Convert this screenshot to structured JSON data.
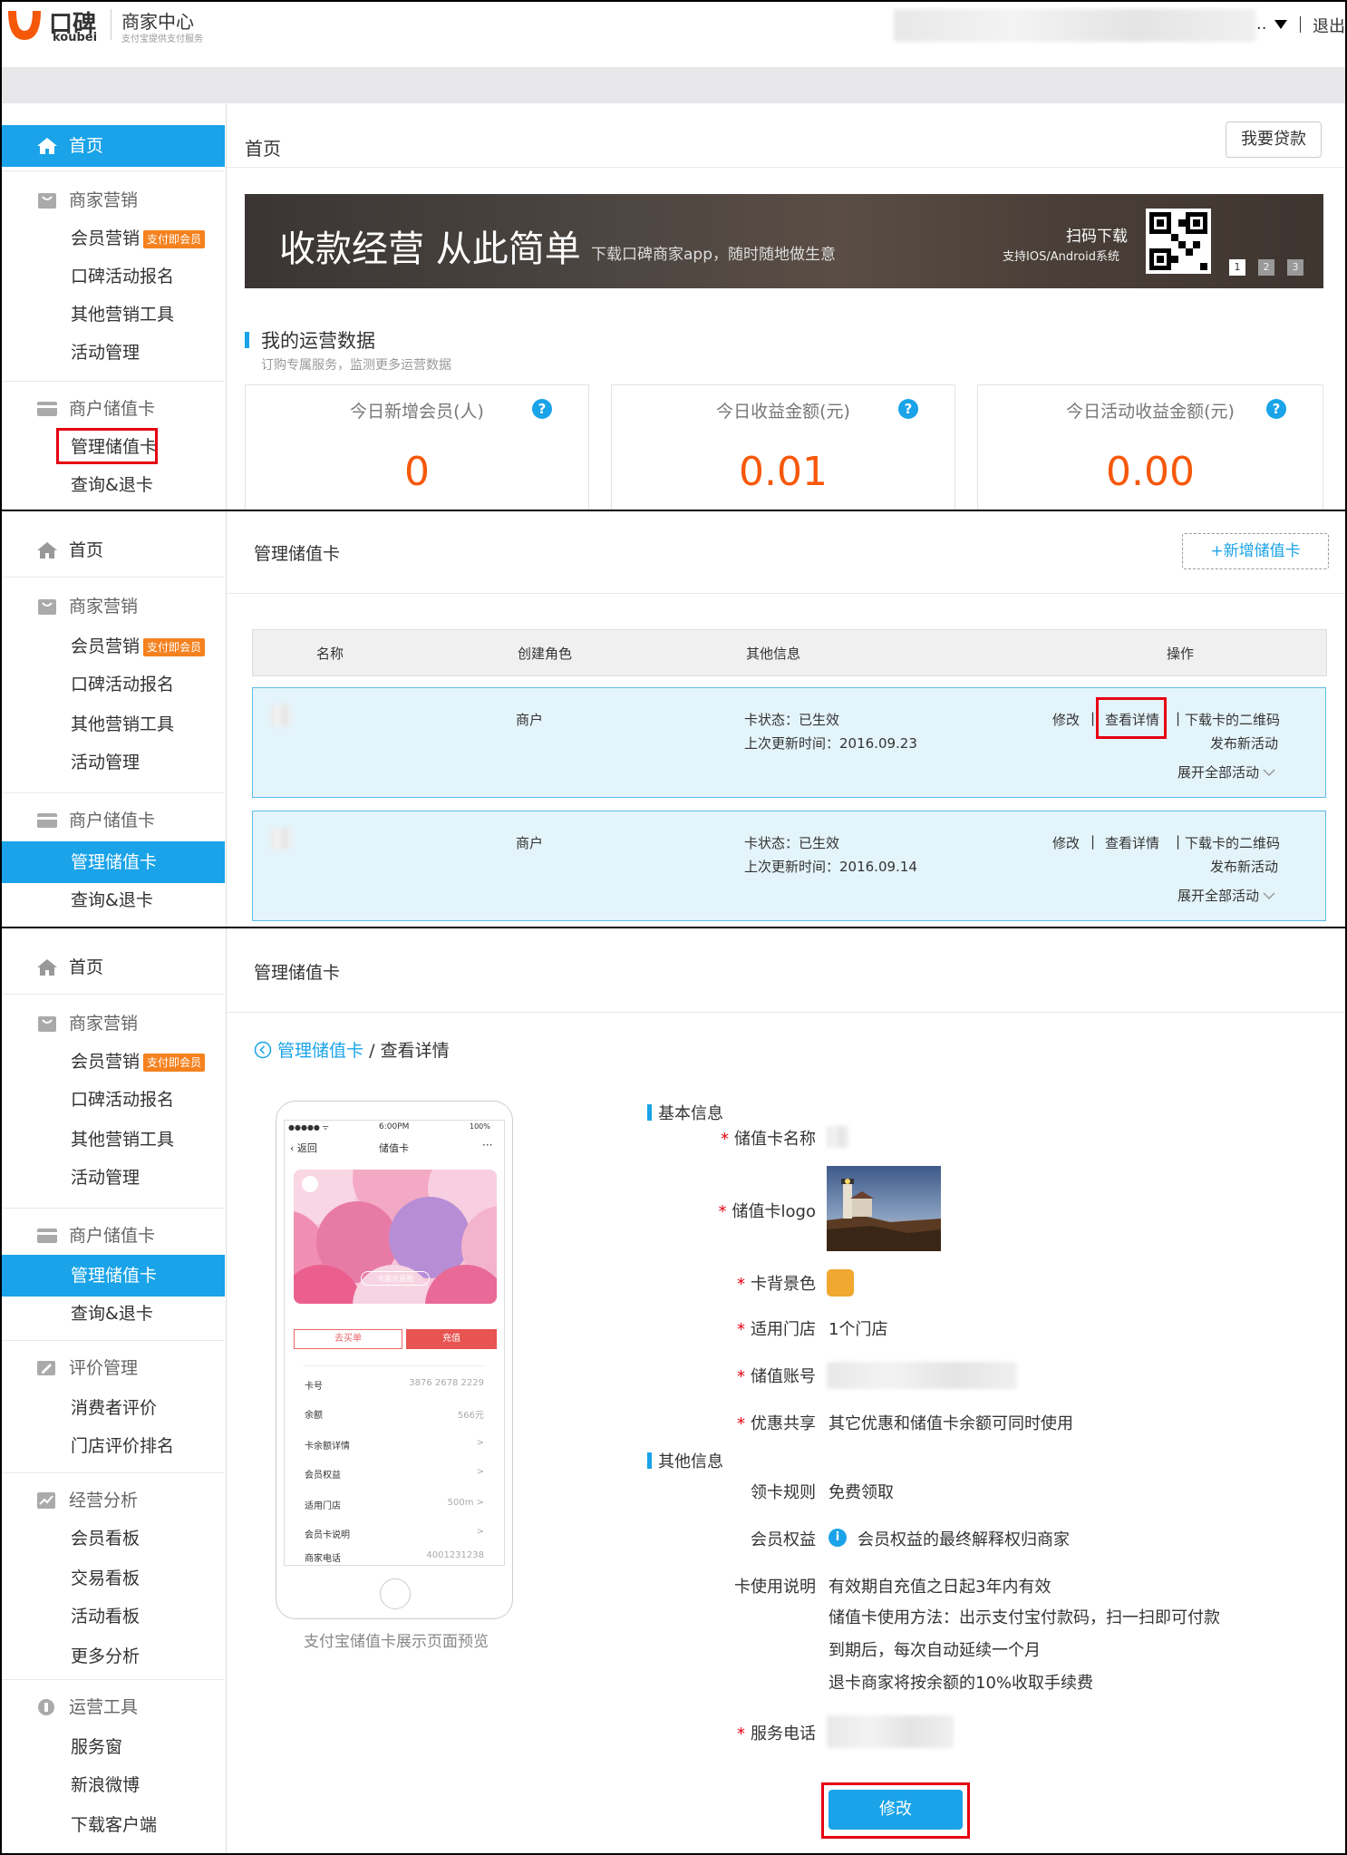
{
  "header": {
    "logo_cn": "口碑",
    "logo_en": "koubei",
    "center_title": "商家中心",
    "center_sub": "支付宝提供支付服务",
    "account_suffix": "..",
    "logout": "退出"
  },
  "sidebar": {
    "home": "首页",
    "marketing_group": "商家营销",
    "member_marketing": "会员营销",
    "member_tag": "支付即会员",
    "activity_signup": "口碑活动报名",
    "other_tools": "其他营销工具",
    "activity_manage": "活动管理",
    "card_group": "商户储值卡",
    "manage_card": "管理储值卡",
    "query_refund": "查询&退卡",
    "review_group": "评价管理",
    "consumer_review": "消费者评价",
    "store_rank": "门店评价排名",
    "analysis_group": "经营分析",
    "member_board": "会员看板",
    "trade_board": "交易看板",
    "activity_board": "活动看板",
    "more_analysis": "更多分析",
    "ops_group": "运营工具",
    "service_window": "服务窗",
    "weibo": "新浪微博",
    "download_client": "下载客户端"
  },
  "panel1": {
    "page_title": "首页",
    "loan_button": "我要贷款",
    "banner_title": "收款经营 从此简单",
    "banner_sub": "下载口碑商家app，随时随地做生意",
    "banner_scan": "扫码下载",
    "banner_os": "支持IOS/Android系统",
    "banner_dots": [
      "1",
      "2",
      "3"
    ],
    "ops_title": "我的运营数据",
    "ops_sub": "订购专属服务，监测更多运营数据",
    "stats": [
      {
        "label": "今日新增会员(人)",
        "value": "0"
      },
      {
        "label": "今日收益金额(元)",
        "value": "0.01"
      },
      {
        "label": "今日活动收益金额(元)",
        "value": "0.00"
      }
    ],
    "help_glyph": "?"
  },
  "panel2": {
    "page_title": "管理储值卡",
    "add_button": "+新增储值卡",
    "columns": [
      "名称",
      "创建角色",
      "其他信息",
      "操作"
    ],
    "rows": [
      {
        "role": "商户",
        "status": "卡状态：已生效",
        "updated": "上次更新时间：2016.09.23"
      },
      {
        "role": "商户",
        "status": "卡状态：已生效",
        "updated": "上次更新时间：2016.09.14"
      }
    ],
    "action_edit": "修改",
    "action_detail": "查看详情",
    "action_qrcode": "下载卡的二维码",
    "action_publish": "发布新活动",
    "action_expand": "展开全部活动",
    "sep": "|"
  },
  "panel3": {
    "page_title": "管理储值卡",
    "breadcrumb_link": "管理储值卡",
    "breadcrumb_sep": "/",
    "breadcrumb_current": "查看详情",
    "phone": {
      "carrier": "●●●●● ᯤ",
      "time": "6:00PM",
      "battery": "100%",
      "back": "返回",
      "title": "储值卡",
      "more": "···",
      "card_button": "卡面示意图",
      "btn_buy": "去买单",
      "btn_recharge": "充值",
      "rows": [
        {
          "label": "卡号",
          "value": "3876 2678 2229"
        },
        {
          "label": "余额",
          "value": "566元"
        },
        {
          "label": "卡余额详情",
          "value": ">"
        },
        {
          "label": "会员权益",
          "value": ">"
        },
        {
          "label": "适用门店",
          "value": "500m >"
        },
        {
          "label": "会员卡说明",
          "value": ">"
        },
        {
          "label": "商家电话",
          "value": "4001231238"
        }
      ],
      "caption": "支付宝储值卡展示页面预览"
    },
    "basic_title": "基本信息",
    "other_title": "其他信息",
    "required_mark": "*",
    "fields": {
      "card_name": "储值卡名称",
      "card_logo": "储值卡logo",
      "bg_color": "卡背景色",
      "stores": "适用门店",
      "stores_value": "1个门店",
      "account": "储值账号",
      "share": "优惠共享",
      "share_value": "其它优惠和储值卡余额可同时使用",
      "rule": "领卡规则",
      "rule_value": "免费领取",
      "rights": "会员权益",
      "rights_value": "会员权益的最终解释权归商家",
      "usage": "卡使用说明",
      "usage_lines": [
        "有效期自充值之日起3年内有效",
        "储值卡使用方法：出示支付宝付款码，扫一扫即可付款",
        "到期后，每次自动延续一个月",
        "退卡商家将按余额的10%收取手续费"
      ],
      "phone": "服务电话"
    },
    "edit_button": "修改",
    "bg_color_hex": "#f0a830"
  }
}
